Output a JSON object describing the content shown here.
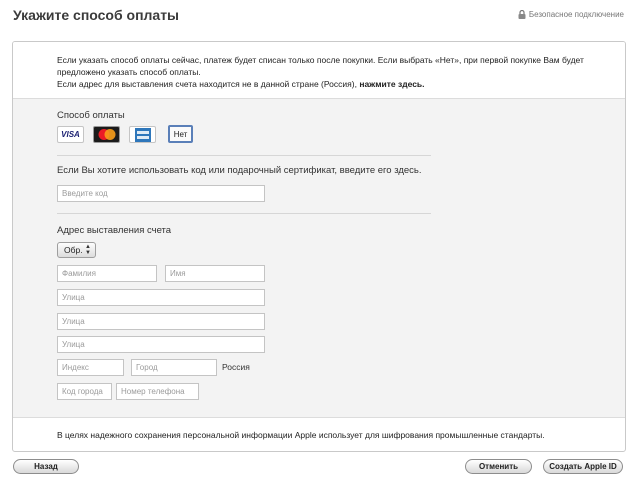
{
  "header": {
    "title": "Укажите способ оплаты",
    "secure_label": "Безопасное подключение"
  },
  "notice": {
    "line1": "Если указать способ оплаты сейчас, платеж будет списан только после покупки. Если выбрать «Нет», при первой покупке Вам будет предложено указать способ оплаты.",
    "line2_text": "Если адрес для выставления счета находится не в данной стране (Россия), ",
    "line2_link": "нажмите здесь."
  },
  "payment": {
    "label": "Способ оплаты",
    "options": [
      {
        "name": "VISA",
        "icon": "visa-card-icon"
      },
      {
        "name": "MasterCard",
        "icon": "mastercard-icon"
      },
      {
        "name": "American Express",
        "icon": "amex-icon"
      },
      {
        "name": "Нет",
        "icon": "none-option"
      }
    ],
    "selected": "Нет"
  },
  "gift": {
    "label": "Если Вы хотите использовать код или подарочный сертификат, введите его здесь.",
    "placeholder": "Введите код"
  },
  "billing": {
    "label": "Адрес выставления счета",
    "salutation": "Обр.",
    "last_name_placeholder": "Фамилия",
    "first_name_placeholder": "Имя",
    "street1_placeholder": "Улица",
    "street2_placeholder": "Улица",
    "street3_placeholder": "Улица",
    "zip_placeholder": "Индекс",
    "city_placeholder": "Город",
    "country": "Россия",
    "area_code_placeholder": "Код города",
    "phone_placeholder": "Номер телефона"
  },
  "footer_note": "В целях надежного сохранения персональной информации Apple использует для шифрования промышленные стандарты.",
  "buttons": {
    "back": "Назад",
    "cancel": "Отменить",
    "create": "Создать Apple ID"
  },
  "colors": {
    "selected_border": "#5a7fb8",
    "form_background": "#f3f3f3"
  }
}
